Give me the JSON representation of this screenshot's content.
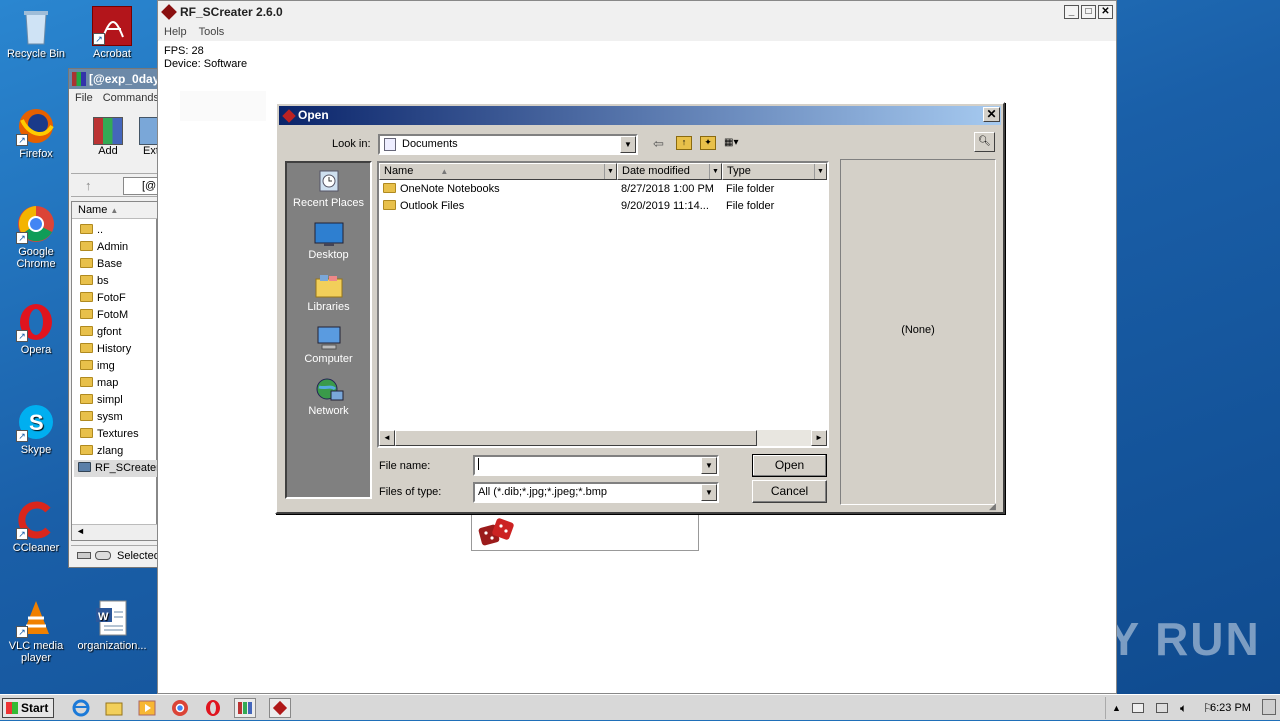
{
  "desktop": {
    "icons": [
      {
        "label": "Recycle Bin",
        "icon": "recycle-bin-icon"
      },
      {
        "label": "Acrobat",
        "icon": "acrobat-icon"
      },
      {
        "label": "Firefox",
        "icon": "firefox-icon"
      },
      {
        "label": "Google Chrome",
        "icon": "chrome-icon"
      },
      {
        "label": "Opera",
        "icon": "opera-icon"
      },
      {
        "label": "Skype",
        "icon": "skype-icon"
      },
      {
        "label": "CCleaner",
        "icon": "ccleaner-icon"
      },
      {
        "label": "VLC media player",
        "icon": "vlc-icon"
      },
      {
        "label": "organization...",
        "icon": "word-doc-icon"
      }
    ],
    "watermark": "ANY RUN"
  },
  "rf_window": {
    "title": "RF_SCreater 2.6.0",
    "menu": [
      "Help",
      "Tools"
    ],
    "fps": "FPS: 28",
    "device": "Device: Software"
  },
  "rar_window": {
    "title": "[@exp_0day",
    "menu": [
      "File",
      "Commands"
    ],
    "toolbar": [
      "Add",
      "Ext"
    ],
    "path": "[@",
    "column": "Name",
    "rows": [
      "..",
      "Admin",
      "Base",
      "bs",
      "FotoF",
      "FotoM",
      "gfont",
      "History",
      "img",
      "map",
      "simpl",
      "sysm",
      "Textures",
      "zlang",
      "RF_SCreater"
    ],
    "status": "Selected"
  },
  "dialog": {
    "title": "Open",
    "look_in_label": "Look in:",
    "look_in_value": "Documents",
    "places": [
      "Recent Places",
      "Desktop",
      "Libraries",
      "Computer",
      "Network"
    ],
    "columns": [
      "Name",
      "Date modified",
      "Type"
    ],
    "files": [
      {
        "name": "OneNote Notebooks",
        "date": "8/27/2018 1:00 PM",
        "type": "File folder"
      },
      {
        "name": "Outlook Files",
        "date": "9/20/2019 11:14...",
        "type": "File folder"
      }
    ],
    "file_name_label": "File name:",
    "file_name_value": "",
    "files_of_type_label": "Files of type:",
    "files_of_type_value": "All (*.dib;*.jpg;*.jpeg;*.bmp",
    "open_button": "Open",
    "cancel_button": "Cancel",
    "preview_text": "(None)"
  },
  "taskbar": {
    "start": "Start",
    "clock": "6:23 PM"
  }
}
